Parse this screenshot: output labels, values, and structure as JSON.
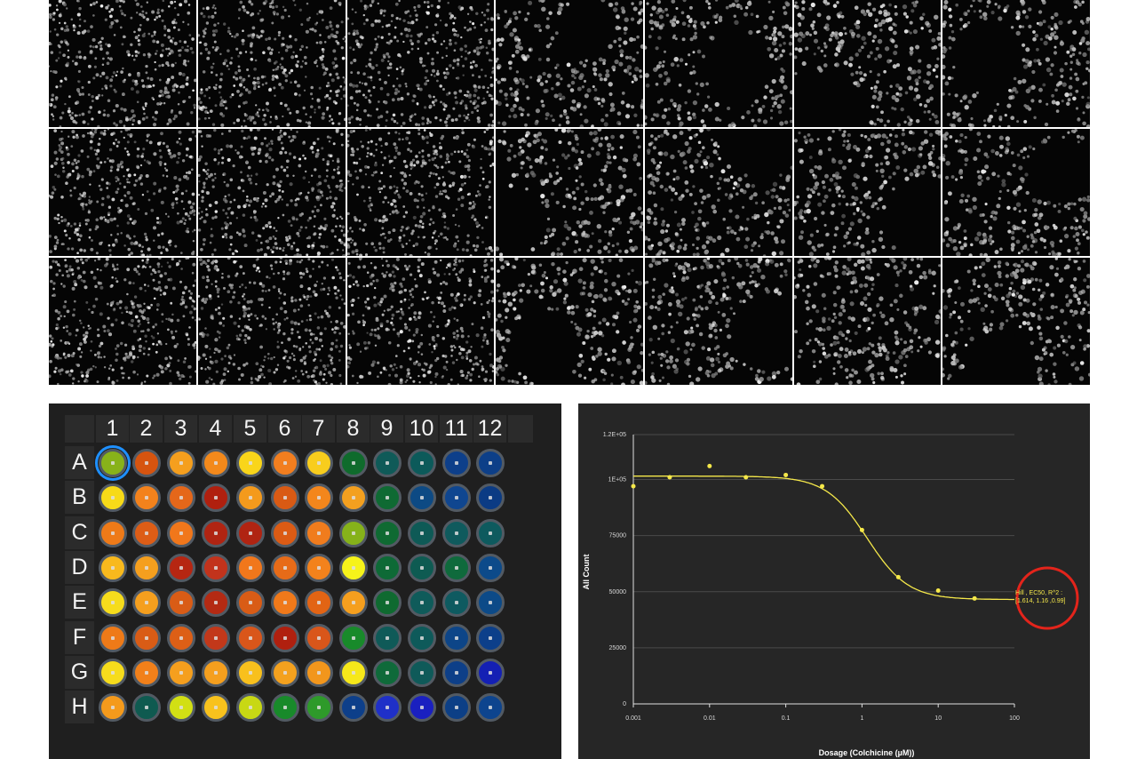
{
  "plate": {
    "columns": [
      "1",
      "2",
      "3",
      "4",
      "5",
      "6",
      "7",
      "8",
      "9",
      "10",
      "11",
      "12"
    ],
    "rows": [
      "A",
      "B",
      "C",
      "D",
      "E",
      "F",
      "G",
      "H"
    ],
    "selected_well": "A1",
    "well_colors": [
      [
        "#88b21a",
        "#d6540f",
        "#f59f1e",
        "#f3891b",
        "#f9d51a",
        "#f27e1f",
        "#f8cd1d",
        "#0f6b2c",
        "#0f5a58",
        "#0c5a5a",
        "#0d3f8a",
        "#0d3f88"
      ],
      [
        "#f7da18",
        "#f3821c",
        "#e5671a",
        "#b0200f",
        "#f49a1c",
        "#d95a14",
        "#f3861c",
        "#f3a01f",
        "#0f6a33",
        "#0d4a84",
        "#0f4690",
        "#0b3b84"
      ],
      [
        "#ee7a18",
        "#dd5d16",
        "#f1771b",
        "#b02412",
        "#b02412",
        "#dc5b14",
        "#f07c1d",
        "#86b21a",
        "#0f6a32",
        "#0e5a56",
        "#0f5a5d",
        "#0e5a5e"
      ],
      [
        "#f8b91d",
        "#f59f1e",
        "#b62612",
        "#c2331c",
        "#f1771b",
        "#e76b18",
        "#f3821c",
        "#f6f31a",
        "#0e6a36",
        "#0e5b52",
        "#0f6a3c",
        "#0c4a8a"
      ],
      [
        "#f6dc1c",
        "#f59f1e",
        "#d95c16",
        "#b42a13",
        "#d95c16",
        "#f0791a",
        "#e26414",
        "#f59f1e",
        "#0f6a30",
        "#0f5b5a",
        "#0e5a60",
        "#0c4a88"
      ],
      [
        "#ee7a18",
        "#d95c16",
        "#dd5f16",
        "#c2381a",
        "#d9561a",
        "#b0200f",
        "#d9561a",
        "#188a2a",
        "#0f5a58",
        "#0e5a5a",
        "#0d4588",
        "#0c3f8a"
      ],
      [
        "#f6dc1c",
        "#f1801a",
        "#f59f1e",
        "#f59f1e",
        "#f8c01d",
        "#f4a11e",
        "#f2961c",
        "#f6e81a",
        "#0f6a3a",
        "#0f5a59",
        "#0d3f88",
        "#1420b4"
      ],
      [
        "#f49a1c",
        "#0f5a50",
        "#d2df14",
        "#f8c21d",
        "#c8d814",
        "#188a2a",
        "#2e9a2a",
        "#0d3f8a",
        "#1f30c8",
        "#1a20c0",
        "#0c3f86",
        "#0d448e"
      ]
    ]
  },
  "chart_data": {
    "type": "scatter",
    "title": "",
    "xlabel": "Dosage (Colchicine (µM))",
    "ylabel": "All Count",
    "x_scale": "log",
    "xlim": [
      0.001,
      100
    ],
    "ylim": [
      0,
      120000
    ],
    "x_ticks": [
      "0.001",
      "0.01",
      "0.1",
      "1",
      "10",
      "100"
    ],
    "y_ticks": [
      "0",
      "25000",
      "50000",
      "75000",
      "1E+05",
      "1.2E+05"
    ],
    "grid": "horizontal",
    "series": [
      {
        "x": [
          0.001,
          0.003,
          0.01,
          0.03,
          0.1,
          0.3,
          1,
          3,
          10,
          30
        ],
        "y": [
          97000,
          101000,
          106000,
          101000,
          102000,
          97000,
          77500,
          56500,
          50500,
          47000
        ],
        "color": "#f5e84a"
      }
    ],
    "fit": {
      "model": "Hill",
      "top": 101500,
      "bottom": 46500,
      "ec50": 1.16,
      "hill": 1.614,
      "color": "#f5e84a"
    },
    "annotation": {
      "line1": "Hill , EC50, R^2 :",
      "line2": "[1.614, 1.16 ,0.99]",
      "circle_color": "#e3241b"
    }
  }
}
